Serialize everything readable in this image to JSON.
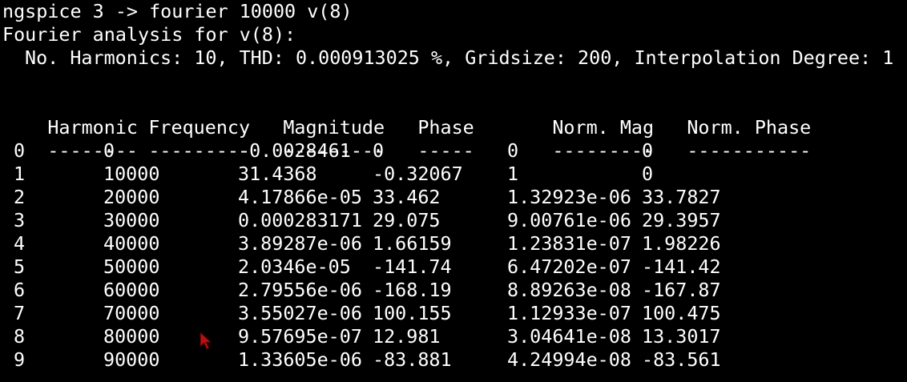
{
  "command_line": "ngspice 3 -> fourier 10000 v(8)",
  "analysis_title": "Fourier analysis for v(8):",
  "summary": "No. Harmonics: 10, THD: 0.000913025 %, Gridsize: 200, Interpolation Degree: 1",
  "table": {
    "headers": [
      "Harmonic",
      "Frequency",
      "Magnitude",
      "Phase",
      "Norm. Mag",
      "Norm. Phase"
    ],
    "separators": [
      "--------",
      "---------",
      "---------",
      "-----",
      "---------",
      "-----------"
    ],
    "rows": [
      [
        "0",
        "0",
        "-0.0028461",
        "0",
        "0",
        "0"
      ],
      [
        "1",
        "10000",
        "31.4368",
        "-0.32067",
        "1",
        "0"
      ],
      [
        "2",
        "20000",
        "4.17866e-05",
        "33.462",
        "1.32923e-06",
        "33.7827"
      ],
      [
        "3",
        "30000",
        "0.000283171",
        "29.075",
        "9.00761e-06",
        "29.3957"
      ],
      [
        "4",
        "40000",
        "3.89287e-06",
        "1.66159",
        "1.23831e-07",
        "1.98226"
      ],
      [
        "5",
        "50000",
        "2.0346e-05",
        "-141.74",
        "6.47202e-07",
        "-141.42"
      ],
      [
        "6",
        "60000",
        "2.79556e-06",
        "-168.19",
        "8.89263e-08",
        "-167.87"
      ],
      [
        "7",
        "70000",
        "3.55027e-06",
        "100.155",
        "1.12933e-07",
        "100.475"
      ],
      [
        "8",
        "80000",
        "9.57695e-07",
        "12.981",
        "3.04641e-08",
        "13.3017"
      ],
      [
        "9",
        "90000",
        "1.33605e-06",
        "-83.881",
        "4.24994e-08",
        "-83.561"
      ]
    ]
  },
  "colors": {
    "background": "#000000",
    "text": "#ffffff",
    "cursor": "#b80f0f"
  },
  "icons": {
    "cursor": "mouse-pointer-icon"
  }
}
